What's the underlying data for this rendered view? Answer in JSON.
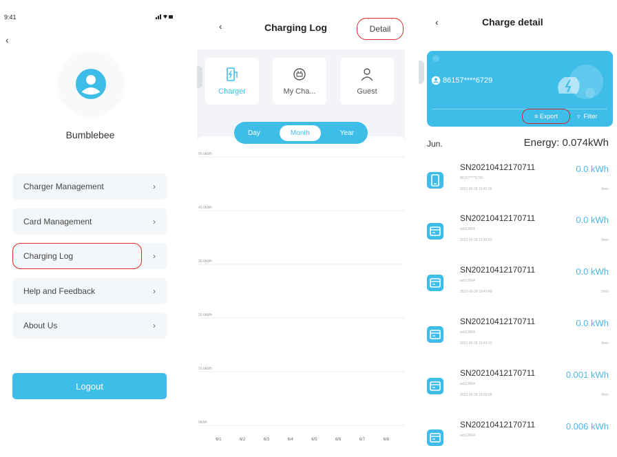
{
  "colors": {
    "accent": "#3ebde9",
    "highlight": "#d62828",
    "panel_bg": "#f2f4f7"
  },
  "menu_screen": {
    "status_time": "9:41",
    "username": "Bumblebee",
    "items": [
      {
        "label": "Charger Management"
      },
      {
        "label": "Card Management"
      },
      {
        "label": "Charging Log"
      },
      {
        "label": "Help and Feedback"
      },
      {
        "label": "About Us"
      }
    ],
    "logout_label": "Logout"
  },
  "charging_log_screen": {
    "title": "Charging Log",
    "detail_label": "Detail",
    "categories": [
      {
        "label": "Charger",
        "icon": "charger-icon",
        "active": true
      },
      {
        "label": "My Cha...",
        "icon": "plug-icon",
        "active": false
      },
      {
        "label": "Guest",
        "icon": "person-icon",
        "active": false
      }
    ],
    "period_tabs": [
      {
        "label": "Day",
        "active": false
      },
      {
        "label": "Month",
        "active": true
      },
      {
        "label": "Year",
        "active": false
      }
    ],
    "chart_data": {
      "type": "bar",
      "categories": [
        "6/1",
        "6/2",
        "6/3",
        "6/4",
        "6/5",
        "6/6",
        "6/7",
        "6/8"
      ],
      "y_labels": [
        "50.0kWh",
        "40.0kWh",
        "30.0kWh",
        "20.0kWh",
        "10.0kWh",
        "0kWh"
      ],
      "values": [
        0,
        0,
        0,
        0,
        0,
        0,
        0,
        0
      ],
      "ylim": [
        0,
        50
      ],
      "grid": true
    }
  },
  "charge_detail_screen": {
    "title": "Charge detail",
    "masked_phone": "86157****6729",
    "export_label": "Export",
    "filter_label": "Filter",
    "month": "Jun.",
    "energy_total": "Energy: 0.074kWh",
    "records": [
      {
        "sn": "SN20210412170711",
        "kwh": "0.0 kWh",
        "user": "86157****6729",
        "time": "2022-06-28 19:45:26",
        "duration": "0min",
        "icon": "tablet-icon"
      },
      {
        "sn": "SN20210412170711",
        "kwh": "0.0 kWh",
        "user": "acb13664",
        "time": "2022-06-28 19:40:53",
        "duration": "0min",
        "icon": "card-icon"
      },
      {
        "sn": "SN20210412170711",
        "kwh": "0.0 kWh",
        "user": "acb13664",
        "time": "2022-06-28 19:40:49",
        "duration": "0min",
        "icon": "card-icon"
      },
      {
        "sn": "SN20210412170711",
        "kwh": "0.0 kWh",
        "user": "acb13664",
        "time": "2022-06-28 19:40:31",
        "duration": "0min",
        "icon": "card-icon"
      },
      {
        "sn": "SN20210412170711",
        "kwh": "0.001 kWh",
        "user": "acb13664",
        "time": "2022-06-28 19:39:28",
        "duration": "0min",
        "icon": "card-icon"
      },
      {
        "sn": "SN20210412170711",
        "kwh": "0.006 kWh",
        "user": "acb13664",
        "time": "",
        "duration": "",
        "icon": "card-icon"
      }
    ]
  }
}
